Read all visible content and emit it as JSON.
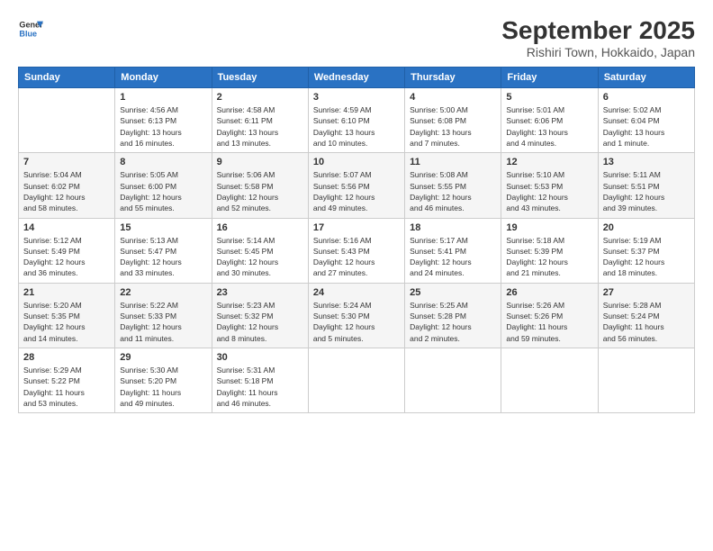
{
  "logo": {
    "line1": "General",
    "line2": "Blue"
  },
  "title": "September 2025",
  "location": "Rishiri Town, Hokkaido, Japan",
  "days_of_week": [
    "Sunday",
    "Monday",
    "Tuesday",
    "Wednesday",
    "Thursday",
    "Friday",
    "Saturday"
  ],
  "weeks": [
    [
      {
        "day": "",
        "info": ""
      },
      {
        "day": "1",
        "info": "Sunrise: 4:56 AM\nSunset: 6:13 PM\nDaylight: 13 hours\nand 16 minutes."
      },
      {
        "day": "2",
        "info": "Sunrise: 4:58 AM\nSunset: 6:11 PM\nDaylight: 13 hours\nand 13 minutes."
      },
      {
        "day": "3",
        "info": "Sunrise: 4:59 AM\nSunset: 6:10 PM\nDaylight: 13 hours\nand 10 minutes."
      },
      {
        "day": "4",
        "info": "Sunrise: 5:00 AM\nSunset: 6:08 PM\nDaylight: 13 hours\nand 7 minutes."
      },
      {
        "day": "5",
        "info": "Sunrise: 5:01 AM\nSunset: 6:06 PM\nDaylight: 13 hours\nand 4 minutes."
      },
      {
        "day": "6",
        "info": "Sunrise: 5:02 AM\nSunset: 6:04 PM\nDaylight: 13 hours\nand 1 minute."
      }
    ],
    [
      {
        "day": "7",
        "info": "Sunrise: 5:04 AM\nSunset: 6:02 PM\nDaylight: 12 hours\nand 58 minutes."
      },
      {
        "day": "8",
        "info": "Sunrise: 5:05 AM\nSunset: 6:00 PM\nDaylight: 12 hours\nand 55 minutes."
      },
      {
        "day": "9",
        "info": "Sunrise: 5:06 AM\nSunset: 5:58 PM\nDaylight: 12 hours\nand 52 minutes."
      },
      {
        "day": "10",
        "info": "Sunrise: 5:07 AM\nSunset: 5:56 PM\nDaylight: 12 hours\nand 49 minutes."
      },
      {
        "day": "11",
        "info": "Sunrise: 5:08 AM\nSunset: 5:55 PM\nDaylight: 12 hours\nand 46 minutes."
      },
      {
        "day": "12",
        "info": "Sunrise: 5:10 AM\nSunset: 5:53 PM\nDaylight: 12 hours\nand 43 minutes."
      },
      {
        "day": "13",
        "info": "Sunrise: 5:11 AM\nSunset: 5:51 PM\nDaylight: 12 hours\nand 39 minutes."
      }
    ],
    [
      {
        "day": "14",
        "info": "Sunrise: 5:12 AM\nSunset: 5:49 PM\nDaylight: 12 hours\nand 36 minutes."
      },
      {
        "day": "15",
        "info": "Sunrise: 5:13 AM\nSunset: 5:47 PM\nDaylight: 12 hours\nand 33 minutes."
      },
      {
        "day": "16",
        "info": "Sunrise: 5:14 AM\nSunset: 5:45 PM\nDaylight: 12 hours\nand 30 minutes."
      },
      {
        "day": "17",
        "info": "Sunrise: 5:16 AM\nSunset: 5:43 PM\nDaylight: 12 hours\nand 27 minutes."
      },
      {
        "day": "18",
        "info": "Sunrise: 5:17 AM\nSunset: 5:41 PM\nDaylight: 12 hours\nand 24 minutes."
      },
      {
        "day": "19",
        "info": "Sunrise: 5:18 AM\nSunset: 5:39 PM\nDaylight: 12 hours\nand 21 minutes."
      },
      {
        "day": "20",
        "info": "Sunrise: 5:19 AM\nSunset: 5:37 PM\nDaylight: 12 hours\nand 18 minutes."
      }
    ],
    [
      {
        "day": "21",
        "info": "Sunrise: 5:20 AM\nSunset: 5:35 PM\nDaylight: 12 hours\nand 14 minutes."
      },
      {
        "day": "22",
        "info": "Sunrise: 5:22 AM\nSunset: 5:33 PM\nDaylight: 12 hours\nand 11 minutes."
      },
      {
        "day": "23",
        "info": "Sunrise: 5:23 AM\nSunset: 5:32 PM\nDaylight: 12 hours\nand 8 minutes."
      },
      {
        "day": "24",
        "info": "Sunrise: 5:24 AM\nSunset: 5:30 PM\nDaylight: 12 hours\nand 5 minutes."
      },
      {
        "day": "25",
        "info": "Sunrise: 5:25 AM\nSunset: 5:28 PM\nDaylight: 12 hours\nand 2 minutes."
      },
      {
        "day": "26",
        "info": "Sunrise: 5:26 AM\nSunset: 5:26 PM\nDaylight: 11 hours\nand 59 minutes."
      },
      {
        "day": "27",
        "info": "Sunrise: 5:28 AM\nSunset: 5:24 PM\nDaylight: 11 hours\nand 56 minutes."
      }
    ],
    [
      {
        "day": "28",
        "info": "Sunrise: 5:29 AM\nSunset: 5:22 PM\nDaylight: 11 hours\nand 53 minutes."
      },
      {
        "day": "29",
        "info": "Sunrise: 5:30 AM\nSunset: 5:20 PM\nDaylight: 11 hours\nand 49 minutes."
      },
      {
        "day": "30",
        "info": "Sunrise: 5:31 AM\nSunset: 5:18 PM\nDaylight: 11 hours\nand 46 minutes."
      },
      {
        "day": "",
        "info": ""
      },
      {
        "day": "",
        "info": ""
      },
      {
        "day": "",
        "info": ""
      },
      {
        "day": "",
        "info": ""
      }
    ]
  ]
}
